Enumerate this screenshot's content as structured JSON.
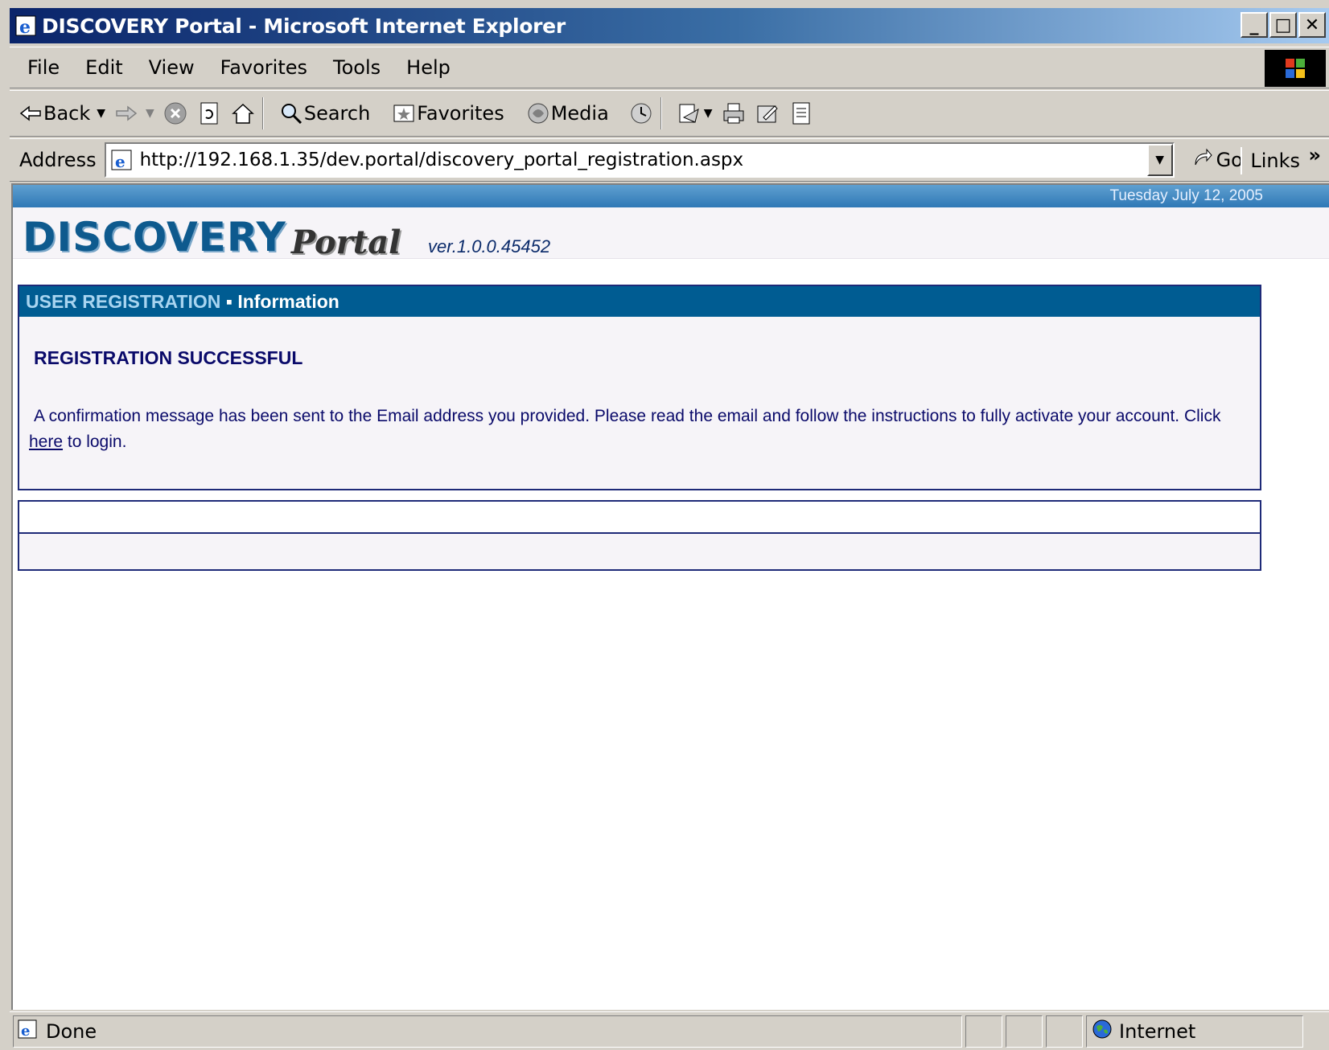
{
  "window": {
    "title": "DISCOVERY Portal - Microsoft Internet Explorer",
    "minimize": "_",
    "maximize": "□",
    "close": "✕"
  },
  "menu": {
    "items": [
      "File",
      "Edit",
      "View",
      "Favorites",
      "Tools",
      "Help"
    ]
  },
  "toolbar": {
    "back": "Back",
    "search": "Search",
    "favorites": "Favorites",
    "media": "Media"
  },
  "address": {
    "label": "Address",
    "url": "http://192.168.1.35/dev.portal/discovery_portal_registration.aspx",
    "go": "Go",
    "links": "Links"
  },
  "page": {
    "date": "Tuesday July 12, 2005",
    "logo_main": "DISCOVERY",
    "logo_portal": "Portal",
    "version": "ver.1.0.0.45452",
    "panel": {
      "crumb": "USER REGISTRATION",
      "separator": " ▪ ",
      "section": "Information",
      "title": "REGISTRATION SUCCESSFUL",
      "msg_before": "A confirmation message has been sent to the Email address you provided. Please read the email and follow the instructions to fully activate your account. Click ",
      "link": "here",
      "msg_after": " to login."
    }
  },
  "status": {
    "text": "Done",
    "zone": "Internet"
  }
}
